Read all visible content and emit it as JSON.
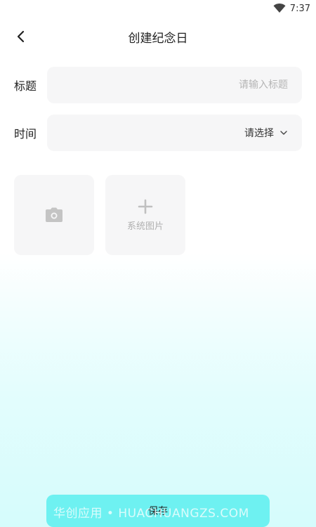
{
  "status": {
    "time": "7:37",
    "wifi_icon": "wifi-icon"
  },
  "header": {
    "title": "创建纪念日",
    "back_icon": "chevron-left-icon"
  },
  "form": {
    "title_row": {
      "label": "标题",
      "placeholder": "请输入标题",
      "value": ""
    },
    "time_row": {
      "label": "时间",
      "value": "请选择",
      "icon": "chevron-down-icon"
    }
  },
  "images": {
    "camera_tile": {
      "icon": "camera-icon"
    },
    "system_tile": {
      "icon": "plus-icon",
      "label": "系统图片"
    }
  },
  "footer": {
    "save_label": "保存",
    "watermark": "华创应用 • HUACHUANGZS.COM"
  },
  "colors": {
    "field_bg": "#f6f6f7",
    "accent": "#6ef1f1",
    "text": "#222222",
    "placeholder": "#b5b5b5"
  }
}
